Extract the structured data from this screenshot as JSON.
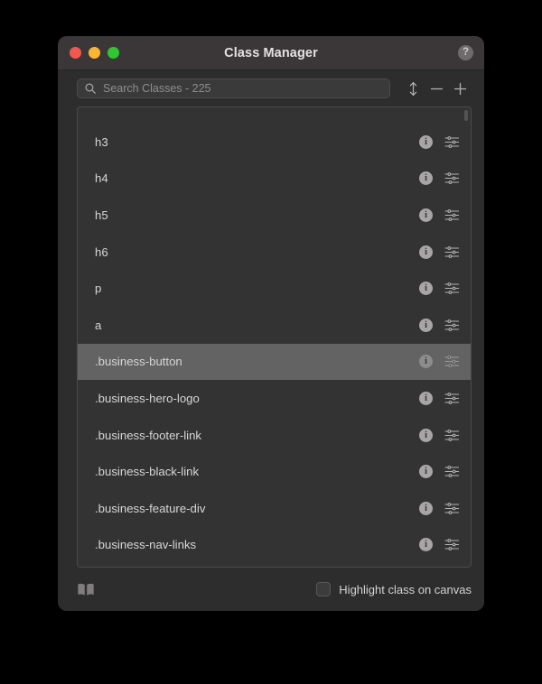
{
  "window": {
    "title": "Class Manager",
    "traffic_lights": [
      {
        "name": "close",
        "color": "#f1594f"
      },
      {
        "name": "minimize",
        "color": "#f9b635"
      },
      {
        "name": "zoom",
        "color": "#2fc732"
      }
    ],
    "help_label": "?"
  },
  "toolbar": {
    "search_icon": "search-icon",
    "search_value": "",
    "search_placeholder": "Search Classes - 225",
    "buttons": [
      {
        "name": "sort-button",
        "icon": "sort-arrows-icon",
        "label": ""
      },
      {
        "name": "remove-button",
        "icon": "minus-icon",
        "label": ""
      },
      {
        "name": "add-button",
        "icon": "plus-icon",
        "label": ""
      }
    ]
  },
  "list": {
    "rows": [
      {
        "label": "h3",
        "selected": false
      },
      {
        "label": "h4",
        "selected": false
      },
      {
        "label": "h5",
        "selected": false
      },
      {
        "label": "h6",
        "selected": false
      },
      {
        "label": "p",
        "selected": false
      },
      {
        "label": "a",
        "selected": false
      },
      {
        "label": ".business-button",
        "selected": true
      },
      {
        "label": ".business-hero-logo",
        "selected": false
      },
      {
        "label": ".business-footer-link",
        "selected": false
      },
      {
        "label": ".business-black-link",
        "selected": false
      },
      {
        "label": ".business-feature-div",
        "selected": false
      },
      {
        "label": ".business-nav-links",
        "selected": false
      }
    ],
    "row_info_icon": "info-icon",
    "row_settings_icon": "sliders-icon"
  },
  "footer": {
    "book_icon": "book-icon",
    "highlight_checked": false,
    "highlight_label": "Highlight class on canvas"
  },
  "colors": {
    "window_bg": "#2d2d2d",
    "titlebar_bg": "#3b3739",
    "list_bg": "#333333",
    "row_selected_bg": "#636363",
    "text": "#d8d6d7",
    "muted_text": "#8e8e8e"
  }
}
